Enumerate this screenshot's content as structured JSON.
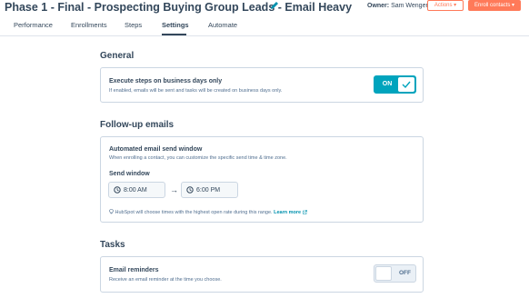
{
  "header": {
    "title": "Phase 1 - Final - Prospecting Buying Group Leads - Email Heavy",
    "owner_label": "Owner:",
    "owner_name": "Sam Wenger",
    "actions_label": "Actions ▾",
    "enroll_label": "Enroll contacts ▾"
  },
  "tabs": [
    {
      "label": "Performance",
      "active": false
    },
    {
      "label": "Enrollments",
      "active": false
    },
    {
      "label": "Steps",
      "active": false
    },
    {
      "label": "Settings",
      "active": true
    },
    {
      "label": "Automate",
      "active": false
    }
  ],
  "general": {
    "title": "General",
    "heading": "Execute steps on business days only",
    "description": "If enabled, emails will be sent and tasks will be created on business days only.",
    "toggle_label": "ON"
  },
  "followup": {
    "title": "Follow-up emails",
    "heading": "Automated email send window",
    "description": "When enrolling a contact, you can customize the specific send time & time zone.",
    "send_window_label": "Send window",
    "start_time": "8:00 AM",
    "arrow": "→",
    "end_time": "6:00 PM",
    "hint_text": "HubSpot will choose times with the highest open rate during this range.",
    "learn_more": "Learn more"
  },
  "tasks": {
    "title": "Tasks",
    "heading": "Email reminders",
    "description": "Receive an email reminder at the time you choose.",
    "toggle_label": "OFF"
  },
  "colors": {
    "accent_orange": "#ff7a59",
    "toggle_teal": "#00a4bd",
    "link": "#0091ae",
    "text": "#33475b"
  }
}
